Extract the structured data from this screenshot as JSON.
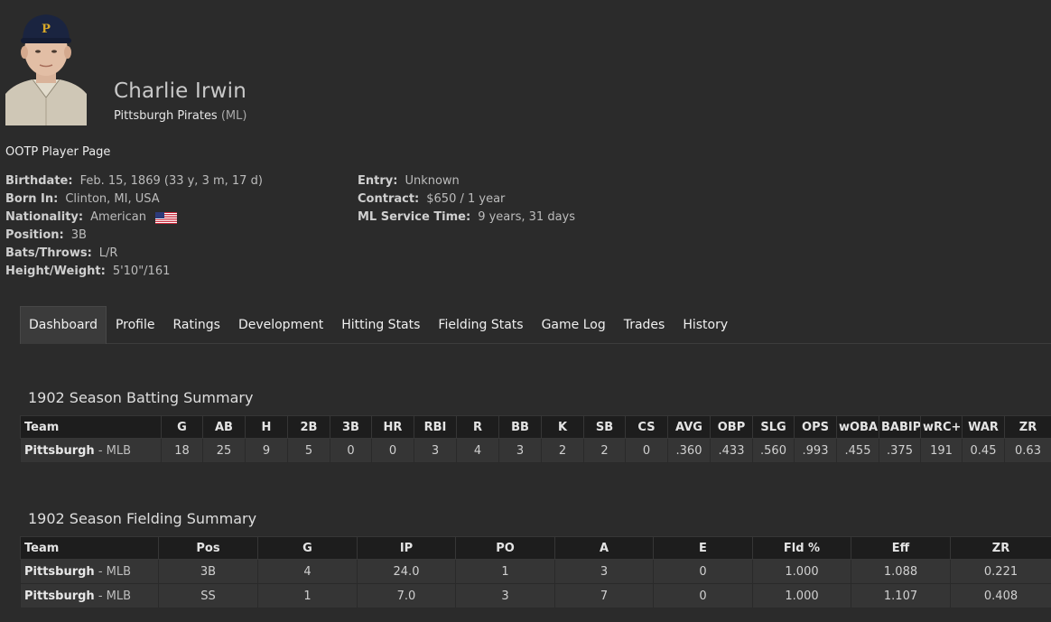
{
  "player": {
    "name": "Charlie Irwin",
    "team": "Pittsburgh Pirates",
    "league": "(ML)",
    "page_label": "OOTP Player Page"
  },
  "info_left": [
    {
      "label": "Birthdate:",
      "value": "Feb. 15, 1869 (33 y, 3 m, 17 d)"
    },
    {
      "label": "Born In:",
      "value": "Clinton, MI, USA"
    },
    {
      "label": "Nationality:",
      "value": "American",
      "flag": "us-flag-icon"
    },
    {
      "label": "Position:",
      "value": "3B"
    },
    {
      "label": "Bats/Throws:",
      "value": "L/R"
    },
    {
      "label": "Height/Weight:",
      "value": "5'10\"/161"
    }
  ],
  "info_right": [
    {
      "label": "Entry:",
      "value": "Unknown"
    },
    {
      "label": "Contract:",
      "value": "$650 / 1 year"
    },
    {
      "label": "ML Service Time:",
      "value": "9 years, 31 days"
    }
  ],
  "tabs": [
    "Dashboard",
    "Profile",
    "Ratings",
    "Development",
    "Hitting Stats",
    "Fielding Stats",
    "Game Log",
    "Trades",
    "History"
  ],
  "active_tab": "Dashboard",
  "batting": {
    "title": "1902 Season Batting Summary",
    "headers": [
      "Team",
      "G",
      "AB",
      "H",
      "2B",
      "3B",
      "HR",
      "RBI",
      "R",
      "BB",
      "K",
      "SB",
      "CS",
      "AVG",
      "OBP",
      "SLG",
      "OPS",
      "wOBA",
      "BABIP",
      "wRC+",
      "WAR",
      "ZR"
    ],
    "rows": [
      {
        "team": "Pittsburgh",
        "level": " - MLB",
        "cells": [
          "18",
          "25",
          "9",
          "5",
          "0",
          "0",
          "3",
          "4",
          "3",
          "2",
          "2",
          "0",
          ".360",
          ".433",
          ".560",
          ".993",
          ".455",
          ".375",
          "191",
          "0.45",
          "0.63"
        ]
      }
    ]
  },
  "fielding": {
    "title": "1902 Season Fielding Summary",
    "headers": [
      "Team",
      "Pos",
      "G",
      "IP",
      "PO",
      "A",
      "E",
      "Fld %",
      "Eff",
      "ZR"
    ],
    "rows": [
      {
        "team": "Pittsburgh",
        "level": " - MLB",
        "cells": [
          "3B",
          "4",
          "24.0",
          "1",
          "3",
          "0",
          "1.000",
          "1.088",
          "0.221"
        ]
      },
      {
        "team": "Pittsburgh",
        "level": " - MLB",
        "cells": [
          "SS",
          "1",
          "7.0",
          "3",
          "7",
          "0",
          "1.000",
          "1.107",
          "0.408"
        ]
      }
    ]
  },
  "colors": {
    "background": "#2b2b2b",
    "header_row": "#1d1d1d",
    "data_row": "#353535",
    "active_tab": "#3b3b3b"
  }
}
